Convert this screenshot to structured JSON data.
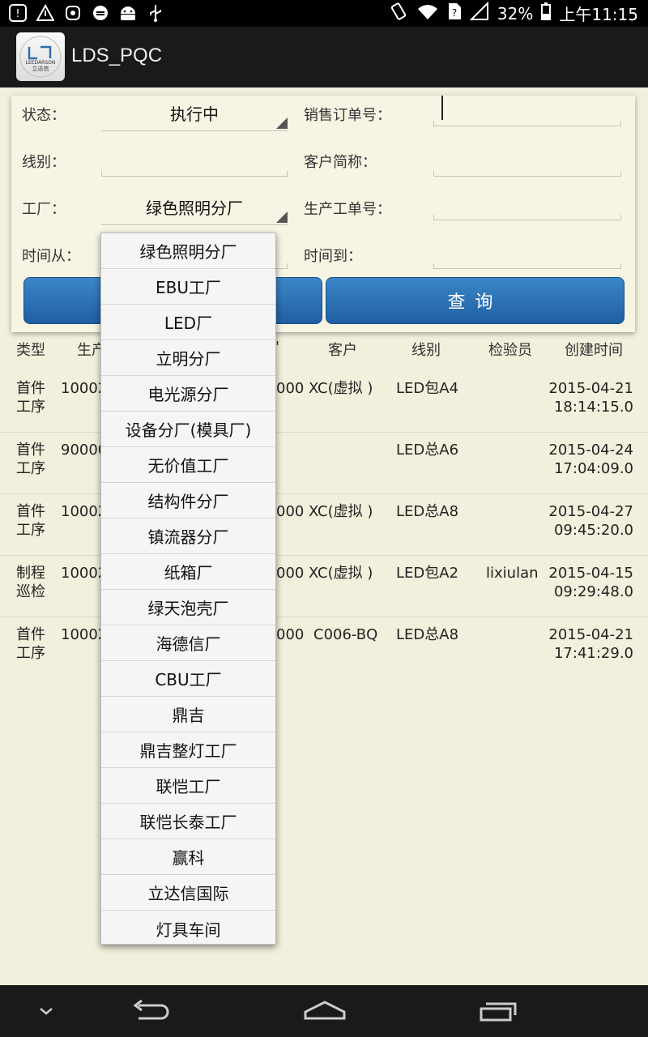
{
  "status_bar": {
    "battery": "32%",
    "time": "上午11:15"
  },
  "app": {
    "title": "LDS_PQC"
  },
  "filters": {
    "status_label": "状态：",
    "status_value": "执行中",
    "sales_order_label": "销售订单号：",
    "line_label": "线别：",
    "customer_short_label": "客户简称：",
    "factory_label": "工厂：",
    "factory_value": "绿色照明分厂",
    "work_order_label": "生产工单号：",
    "time_from_label": "时间从：",
    "time_to_label": "时间到：",
    "query_button": "查询"
  },
  "table": {
    "headers": [
      "类型",
      "生产",
      "客户",
      "线别",
      "检验员",
      "创建时间"
    ],
    "header_partial": "'",
    "rows": [
      {
        "type": [
          "首件",
          "工序"
        ],
        "prod": "10002",
        "mid": "000",
        "customer": "XC(虚拟 )",
        "line": "LED包A4",
        "inspector": "",
        "time": [
          "2015-04-21",
          "18:14:15.0"
        ]
      },
      {
        "type": [
          "首件",
          "工序"
        ],
        "prod": "90000",
        "mid": "",
        "customer": "",
        "line": "LED总A6",
        "inspector": "",
        "time": [
          "2015-04-24",
          "17:04:09.0"
        ]
      },
      {
        "type": [
          "首件",
          "工序"
        ],
        "prod": "10002",
        "mid": "000",
        "customer": "XC(虚拟 )",
        "line": "LED总A8",
        "inspector": "",
        "time": [
          "2015-04-27",
          "09:45:20.0"
        ]
      },
      {
        "type": [
          "制程",
          "巡检"
        ],
        "prod": "10002",
        "mid": "000",
        "customer": "XC(虚拟 )",
        "line": "LED包A2",
        "inspector": "lixiulan",
        "time": [
          "2015-04-15",
          "09:29:48.0"
        ]
      },
      {
        "type": [
          "首件",
          "工序"
        ],
        "prod": "10002",
        "mid": "000",
        "customer": "C006-BQ",
        "line": "LED总A8",
        "inspector": "",
        "time": [
          "2015-04-21",
          "17:41:29.0"
        ]
      }
    ]
  },
  "dropdown": {
    "items": [
      "绿色照明分厂",
      "EBU工厂",
      "LED厂",
      "立明分厂",
      "电光源分厂",
      "设备分厂(模具厂)",
      "无价值工厂",
      "结构件分厂",
      "镇流器分厂",
      "纸箱厂",
      "绿天泡壳厂",
      "海德信厂",
      "CBU工厂",
      "鼎吉",
      "鼎吉整灯工厂",
      "联恺工厂",
      "联恺长泰工厂",
      "赢科",
      "立达信国际",
      "灯具车间"
    ]
  },
  "logo": {
    "text": "LEEDARSON",
    "cn": "立达信"
  }
}
